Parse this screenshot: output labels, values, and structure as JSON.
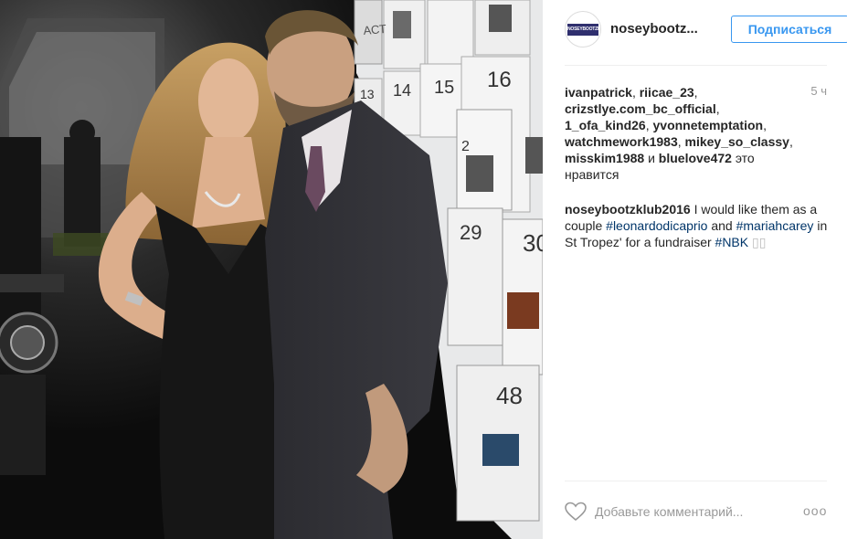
{
  "post": {
    "photo": {
      "icon": "photo-image",
      "board_numbers": [
        "АСТ",
        "13",
        "14",
        "15",
        "16",
        "2",
        "29",
        "30",
        "48"
      ]
    },
    "header": {
      "avatar_text": "NOSEYBOOTZKLUB",
      "username": "noseybootz...",
      "follow_label": "Подписаться"
    },
    "likes": {
      "users": [
        "ivanpatrick",
        "riicae_23",
        "crizstlye.com_bc_official",
        "1_ofa_kind26",
        "yvonnetemptation",
        "watchmework1983",
        "mikey_so_classy",
        "misskim1988"
      ],
      "last_user": "bluelove472",
      "and_word": "и",
      "suffix": "это нравится"
    },
    "time": "5 ч",
    "caption": {
      "username": "noseybootzklub2016",
      "text_1": "I would like them as a couple",
      "tag_1": "#leonardodicaprio",
      "text_2": "and",
      "tag_2": "#mariahcarey",
      "text_3": "in St Tropez' for a fundraiser",
      "tag_3": "#NBK",
      "emoji": "▯▯"
    },
    "footer": {
      "comment_placeholder": "Добавьте комментарий...",
      "more_label": "ooo"
    },
    "colors": {
      "accent": "#3897f0",
      "hashtag": "#003569",
      "muted": "#999999",
      "text": "#262626"
    }
  }
}
